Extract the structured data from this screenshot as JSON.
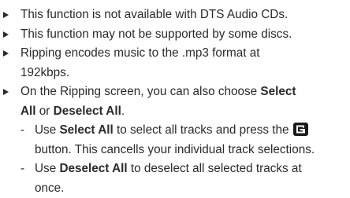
{
  "notes": [
    {
      "lines": [
        "This function is not available with DTS Audio CDs."
      ]
    },
    {
      "lines": [
        "This function may not be supported by some discs."
      ]
    },
    {
      "lines": [
        "Ripping encodes music to the .mp3 format at",
        "192kbps."
      ]
    },
    {
      "line1_pre": "On the Ripping screen, you can also choose ",
      "line1_bold": "Select",
      "line2_bold": "All",
      "line2_mid": " or ",
      "line2_bold2": "Deselect All",
      "line2_post": ".",
      "sub_items": [
        {
          "dash": "-",
          "line1_pre": "Use ",
          "line1_bold": "Select All",
          "line1_post": " to select all tracks and press the",
          "line2": "button. This cancells your individual track selections.",
          "icon": "enter-button-icon"
        },
        {
          "dash": "-",
          "line1_pre": "Use ",
          "line1_bold": "Deselect All",
          "line1_post": " to deselect all selected tracks at",
          "line2": "once."
        }
      ]
    }
  ],
  "colors": {
    "text": "#2a2a2a",
    "icon_bg": "#1a1a1a",
    "icon_fg": "#ffffff"
  }
}
